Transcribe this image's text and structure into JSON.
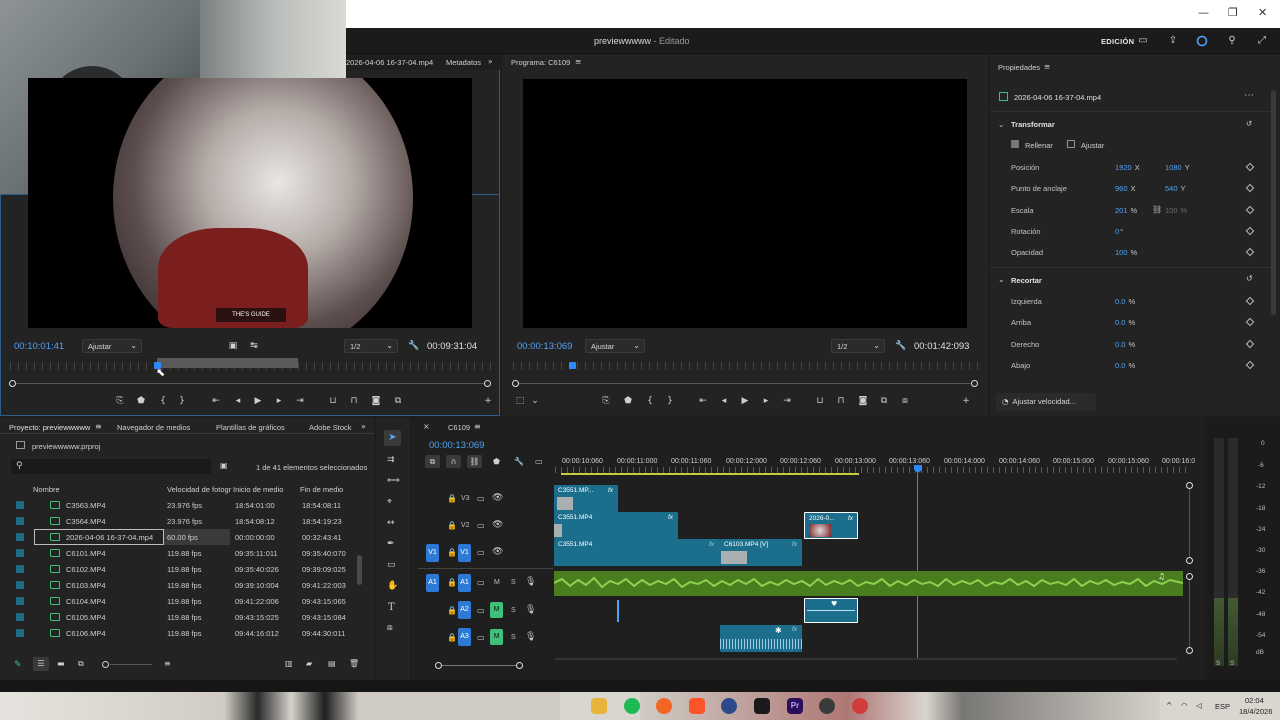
{
  "window": {
    "title": "previewwwww",
    "title_suffix": "- Editado",
    "mode_label": "EDICIÓN",
    "controls": [
      "—",
      "❐",
      "✕"
    ]
  },
  "source_monitor": {
    "tab_name": "2026-04-06 16-37-04.mp4",
    "metadata_tab": "Metadatos",
    "timecode": "00:10:01:41",
    "fit_label": "Ajustar",
    "resolution": "1/2",
    "duration": "00:09:31:04"
  },
  "program_monitor": {
    "tab_name": "Programa: C6109",
    "timecode": "00:00:13:069",
    "fit_label": "Ajustar",
    "resolution": "1/2",
    "duration": "00:01:42:093"
  },
  "properties": {
    "panel_title": "Propiedades",
    "clip_name": "2026-04-06 16-37-04.mp4",
    "transform_title": "Transformar",
    "fill_label": "Rellenar",
    "fit_label": "Ajustar",
    "rows": [
      {
        "label": "Posición",
        "v1": "1920",
        "u1": "X",
        "v2": "1080",
        "u2": "Y"
      },
      {
        "label": "Punto de anclaje",
        "v1": "960",
        "u1": "X",
        "v2": "540",
        "u2": "Y"
      },
      {
        "label": "Escala",
        "v1": "201",
        "u1": "%",
        "v2": "100",
        "u2": "%"
      },
      {
        "label": "Rotación",
        "v1": "0",
        "u1": "°",
        "v2": "",
        "u2": ""
      },
      {
        "label": "Opacidad",
        "v1": "100",
        "u1": "%",
        "v2": "",
        "u2": ""
      }
    ],
    "crop_title": "Recortar",
    "crop_rows": [
      {
        "label": "Izquierda",
        "v1": "0.0",
        "u1": "%"
      },
      {
        "label": "Arriba",
        "v1": "0.0",
        "u1": "%"
      },
      {
        "label": "Derecho",
        "v1": "0.0",
        "u1": "%"
      },
      {
        "label": "Abajo",
        "v1": "0.0",
        "u1": "%"
      }
    ],
    "speed_button": "Ajustar velocidad..."
  },
  "project": {
    "tabs": [
      "Proyecto: previewwwww",
      "Navegador de medios",
      "Plantillas de gráficos",
      "Adobe Stock"
    ],
    "file_name": "previewwwww.prproj",
    "selection_status": "1 de 41 elementos seleccionados",
    "columns": [
      "Nombre",
      "Velocidad de fotogr",
      "Inicio de medio",
      "Fin de medio"
    ],
    "rows": [
      {
        "name": "C3563.MP4",
        "fps": "23.976 fps",
        "start": "18:54:01:00",
        "end": "18:54:08:11"
      },
      {
        "name": "C3564.MP4",
        "fps": "23.976 fps",
        "start": "18:54:08:12",
        "end": "18:54:19:23"
      },
      {
        "name": "2026-04-06 16-37-04.mp4",
        "fps": "60.00 fps",
        "start": "00:00:00:00",
        "end": "00:32:43:41"
      },
      {
        "name": "C6101.MP4",
        "fps": "119.88 fps",
        "start": "09:35:11:011",
        "end": "09:35:40:070"
      },
      {
        "name": "C6102.MP4",
        "fps": "119.88 fps",
        "start": "09:35:40:026",
        "end": "09:39:09:025"
      },
      {
        "name": "C6103.MP4",
        "fps": "119.88 fps",
        "start": "09:39:10:004",
        "end": "09:41:22:003"
      },
      {
        "name": "C6104.MP4",
        "fps": "119.88 fps",
        "start": "09:41:22:006",
        "end": "09:43:15:065"
      },
      {
        "name": "C6105.MP4",
        "fps": "119.88 fps",
        "start": "09:43:15:025",
        "end": "09:43:15:084"
      },
      {
        "name": "C6106.MP4",
        "fps": "119.88 fps",
        "start": "09:44:16:012",
        "end": "09:44:30:011"
      }
    ]
  },
  "timeline": {
    "sequence_name": "C6109",
    "timecode": "00:00:13:069",
    "ruler": [
      "00:00:10:060",
      "00:00:11:000",
      "00:00:11:060",
      "00:00:12:000",
      "00:00:12:060",
      "00:00:13:000",
      "00:00:13:060",
      "00:00:14:000",
      "00:00:14:060",
      "00:00:15:000",
      "00:00:15:060",
      "00:00:16:0"
    ],
    "tracks": {
      "v3": "V3",
      "v2": "V2",
      "v1": "V1",
      "a1": "A1",
      "a2": "A2",
      "a3": "A3",
      "m": "M",
      "s": "S"
    },
    "clips": {
      "v3_a": "C3551.MP...",
      "v2_a": "C3551.MP4",
      "v2_b": "2026-0...",
      "v1_a": "C3551.MP4",
      "v1_b": "C6103.MP4 [V]",
      "fx": "fx"
    }
  },
  "meter": {
    "scale": [
      "0",
      "-6",
      "-12",
      "-18",
      "-24",
      "-30",
      "-36",
      "-42",
      "-48",
      "-54",
      "dB"
    ],
    "solo": [
      "S",
      "S"
    ]
  },
  "taskbar": {
    "language": "ESP",
    "time": "02:04",
    "date": "18/4/2026"
  }
}
